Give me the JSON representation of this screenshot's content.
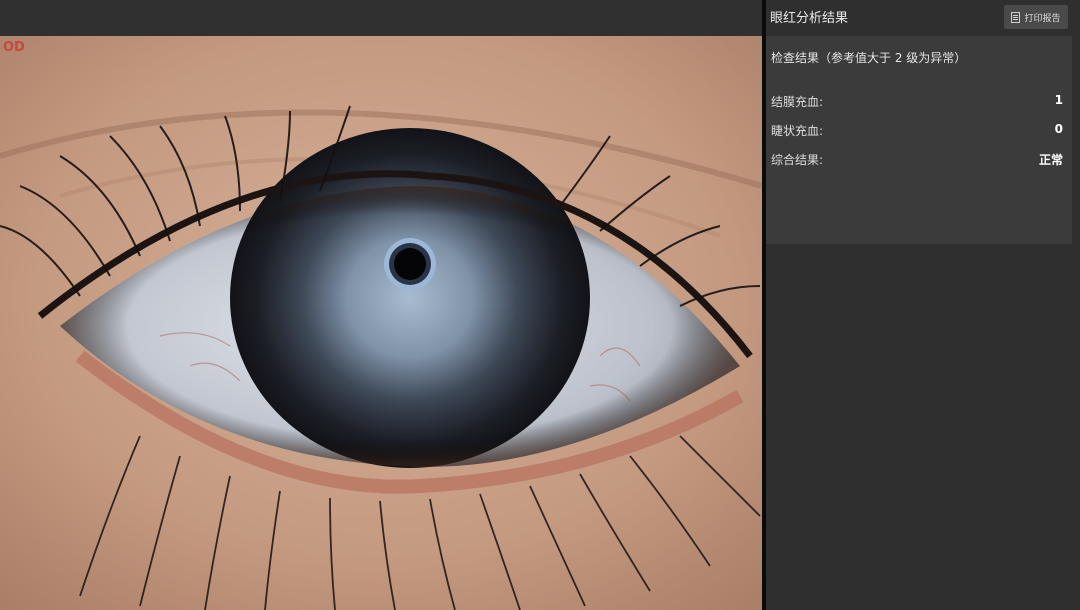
{
  "image_view": {
    "eye_side_label": "OD"
  },
  "panel": {
    "title": "眼红分析结果",
    "print_button_label": "打印报告",
    "print_button_icon": "document-icon"
  },
  "results": {
    "heading": "检查结果（参考值大于 2 级为异常）",
    "rows": [
      {
        "label": "结膜充血:",
        "value": "1"
      },
      {
        "label": "睫状充血:",
        "value": "0"
      },
      {
        "label": "综合结果:",
        "value": "正常"
      }
    ]
  },
  "colors": {
    "panel_bg": "#2f2f2f",
    "card_bg": "#3b3b3b",
    "eye_label": "#c9473f"
  }
}
